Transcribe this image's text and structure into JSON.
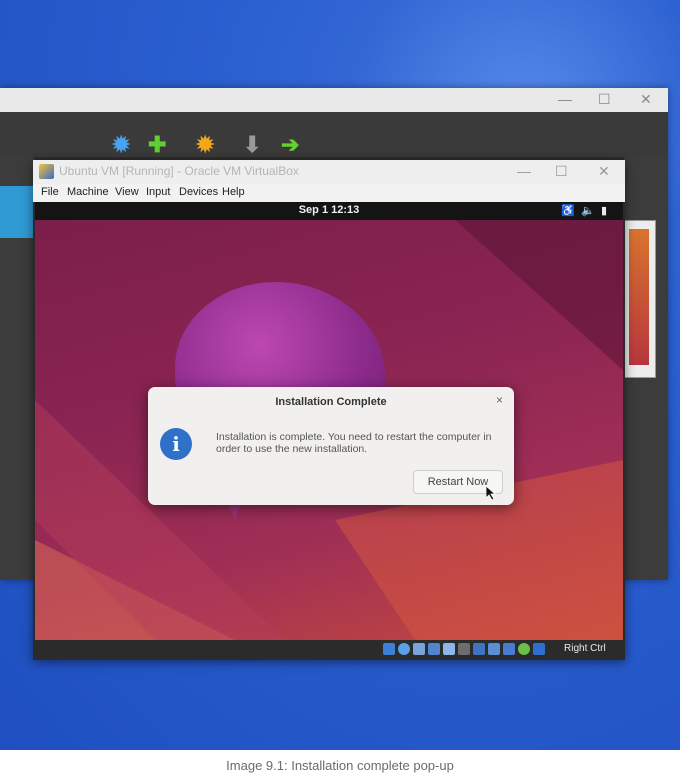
{
  "manager": {
    "controls": [
      "—",
      "☐",
      "✕"
    ],
    "toolbar_icons": [
      "preferences-icon",
      "new-icon",
      "settings-icon",
      "discard-icon",
      "start-icon"
    ]
  },
  "vm_window": {
    "title": "Ubuntu VM [Running] - Oracle VM VirtualBox",
    "controls": [
      "—",
      "☐",
      "✕"
    ],
    "menu": [
      "File",
      "Machine",
      "View",
      "Input",
      "Devices",
      "Help"
    ]
  },
  "ubuntu": {
    "clock": "Sep 1  12:13",
    "tray_icons": [
      "accessibility-icon",
      "volume-icon",
      "battery-icon"
    ]
  },
  "dialog": {
    "title": "Installation Complete",
    "close": "×",
    "info_glyph": "i",
    "message": "Installation is complete. You need to restart the computer in order to use the new installation.",
    "button": "Restart Now"
  },
  "statusbar": {
    "host_key": "Right Ctrl",
    "icons": [
      "hdd-icon",
      "optical-icon",
      "audio-icon",
      "network-icon",
      "usb-icon",
      "shared-folder-icon",
      "display-icon",
      "recording-icon",
      "cpu-icon",
      "mouse-icon",
      "keyboard-icon"
    ]
  },
  "caption": "Image 9.1: Installation complete pop-up"
}
